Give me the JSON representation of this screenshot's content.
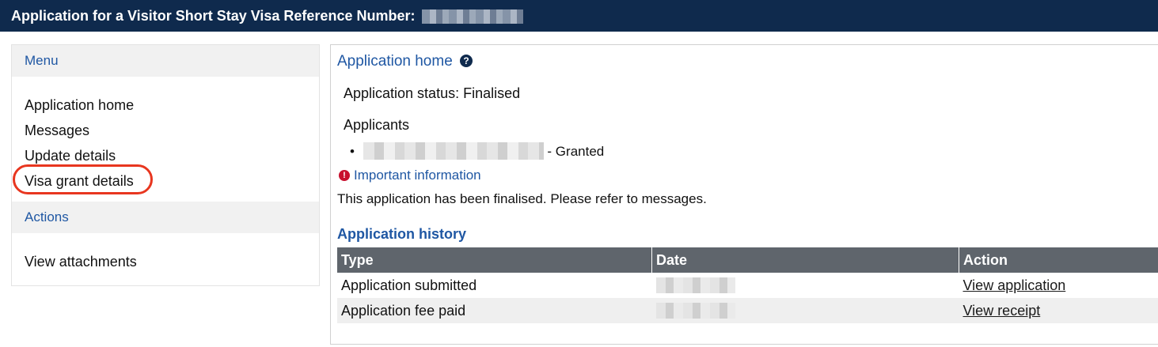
{
  "header": {
    "title": "Application for a Visitor Short Stay Visa Reference Number:"
  },
  "sidebar": {
    "menu_heading": "Menu",
    "menu_items": [
      {
        "label": "Application home"
      },
      {
        "label": "Messages"
      },
      {
        "label": "Update details"
      },
      {
        "label": "Visa grant details"
      }
    ],
    "actions_heading": "Actions",
    "action_items": [
      {
        "label": "View attachments"
      }
    ]
  },
  "main": {
    "title": "Application home",
    "status_text": "Application status: Finalised",
    "applicants_heading": "Applicants",
    "applicant_status": "- Granted",
    "important_link": "Important information",
    "finalised_text": "This application has been finalised. Please refer to messages.",
    "history_heading": "Application history",
    "table": {
      "headers": [
        "Type",
        "Date",
        "Action"
      ],
      "rows": [
        {
          "type": "Application submitted",
          "action": "View application"
        },
        {
          "type": "Application fee paid",
          "action": "View receipt"
        }
      ]
    }
  },
  "colors": {
    "header_bg": "#0f2a4d",
    "link_blue": "#1f57a3",
    "highlight_ring": "#e8361f",
    "table_header_bg": "#5f656c"
  },
  "icons": {
    "help": "question-circle-icon",
    "info": "exclamation-circle-icon"
  }
}
